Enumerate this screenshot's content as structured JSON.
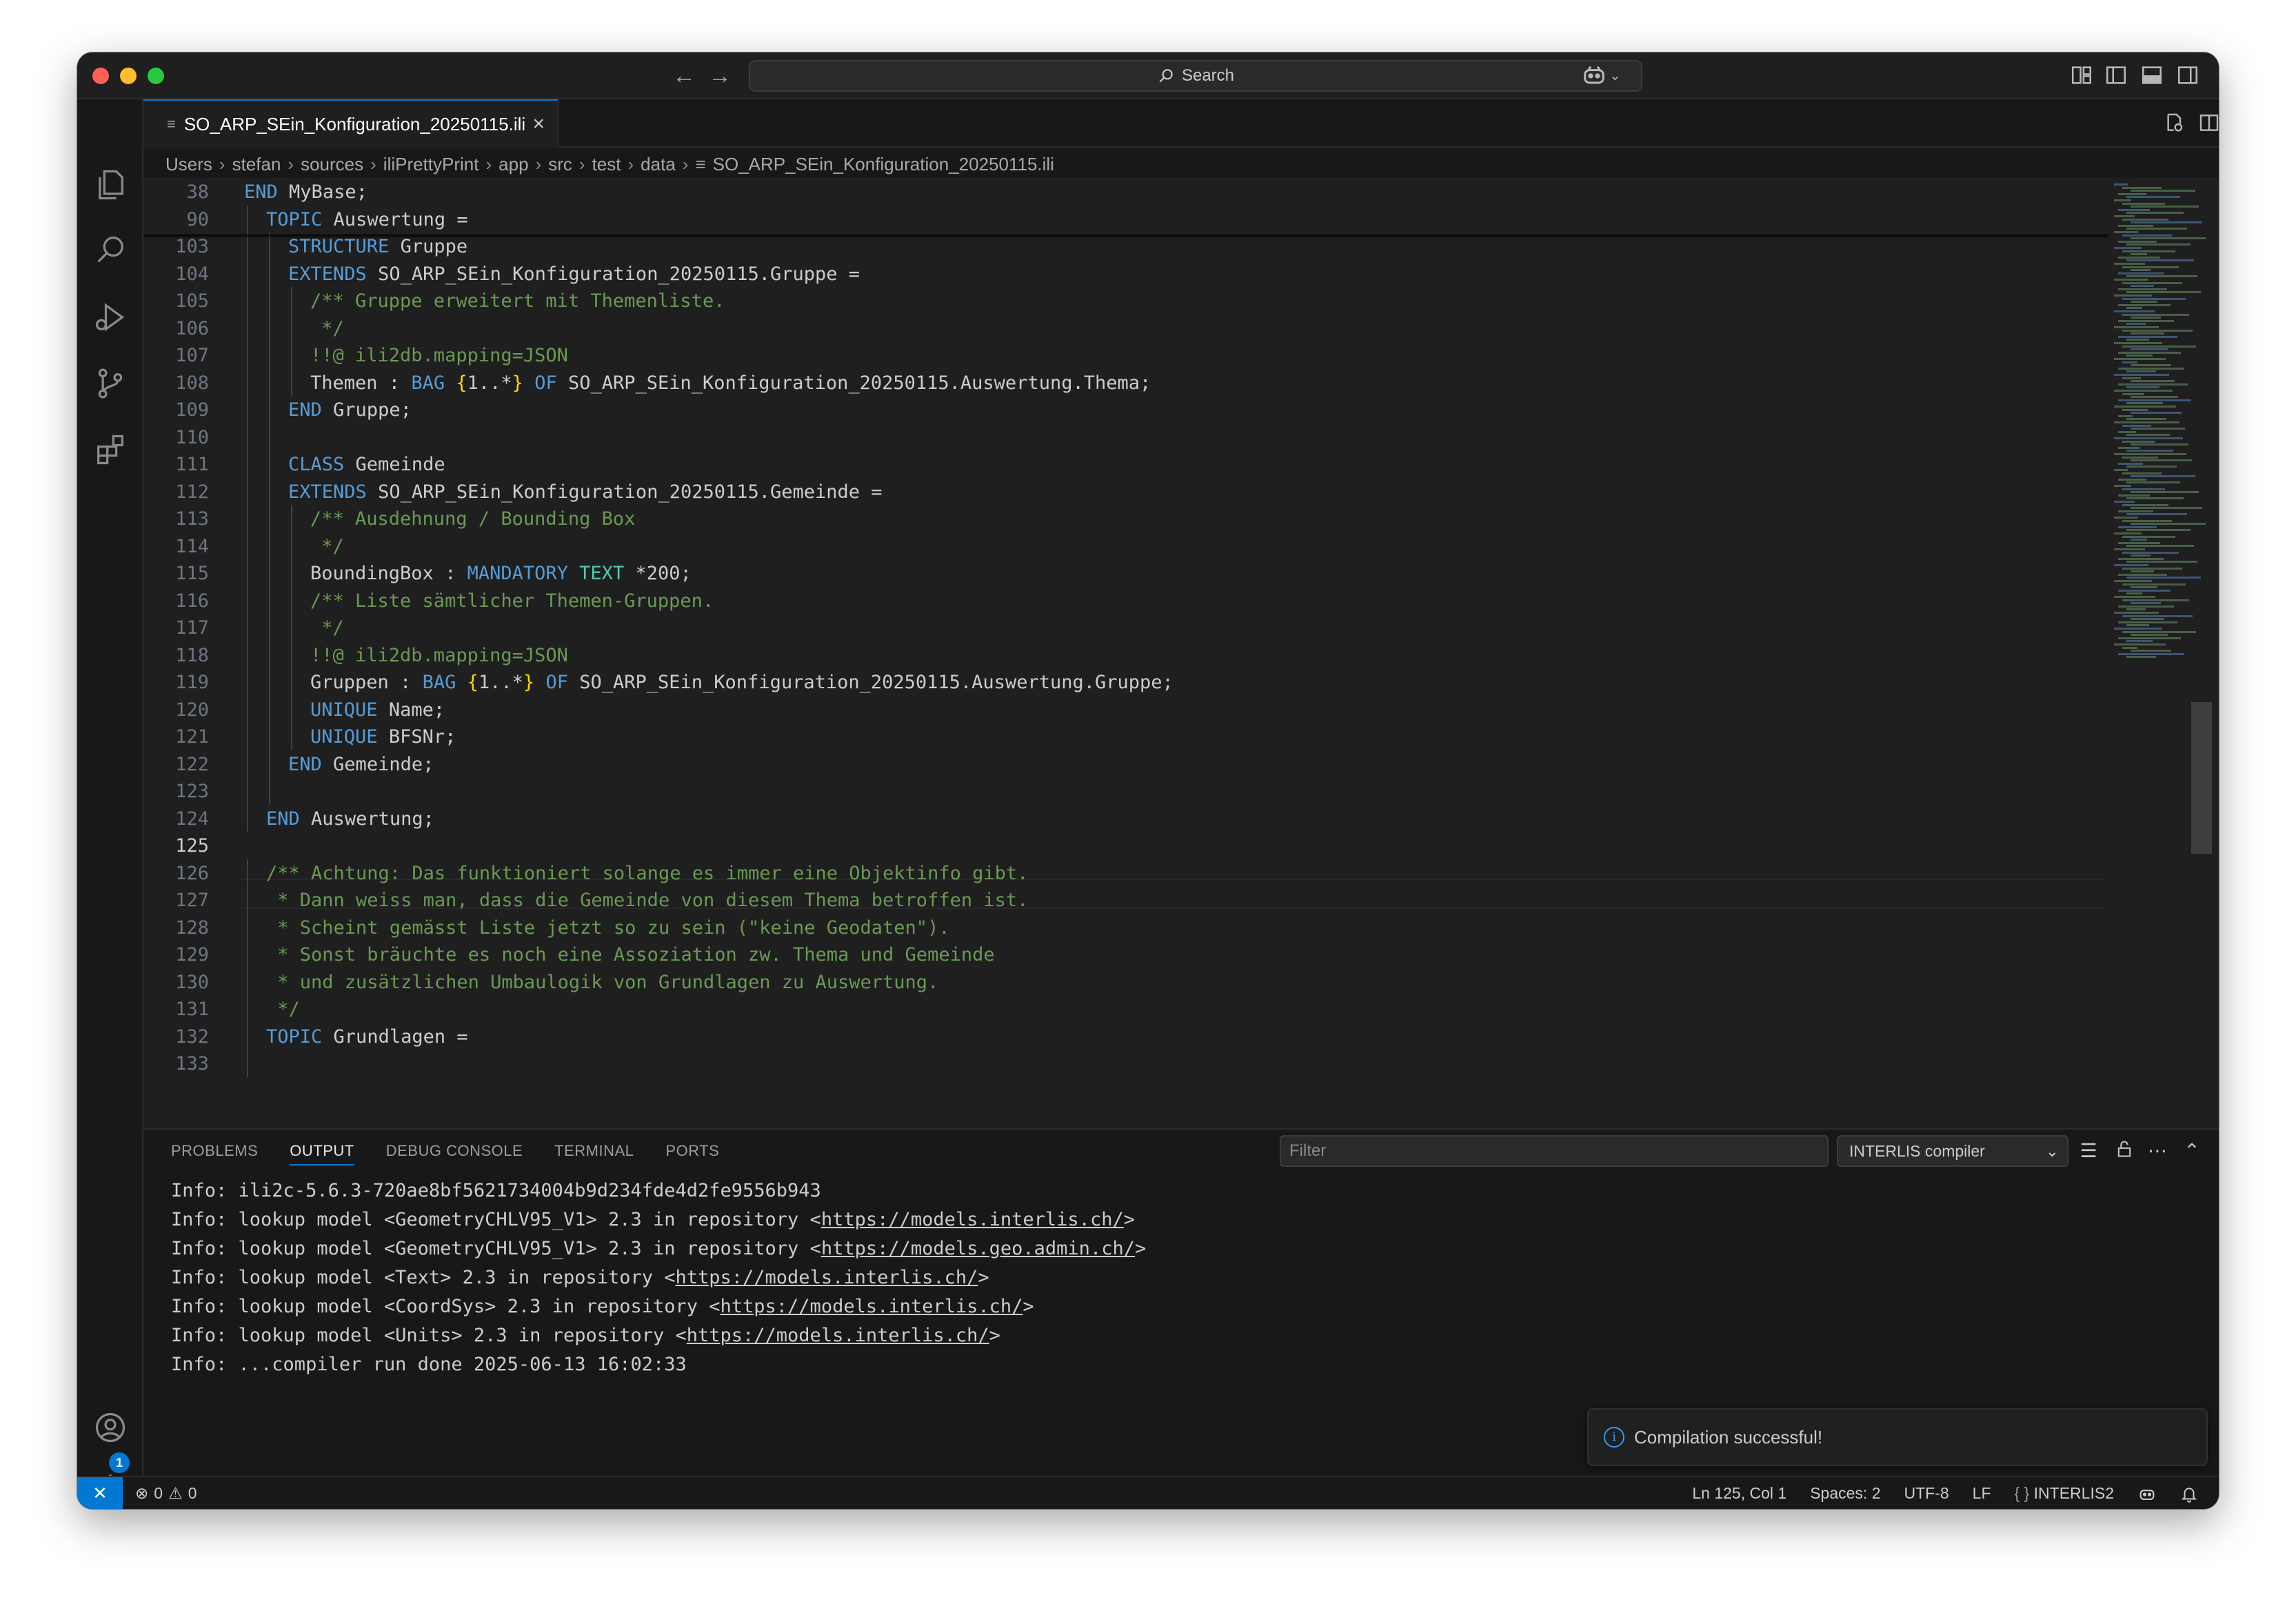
{
  "titlebar": {
    "search_label": "Search"
  },
  "tab": {
    "filename": "SO_ARP_SEin_Konfiguration_20250115.ili"
  },
  "breadcrumb": [
    "Users",
    "stefan",
    "sources",
    "iliPrettyPrint",
    "app",
    "src",
    "test",
    "data",
    "SO_ARP_SEin_Konfiguration_20250115.ili"
  ],
  "editor": {
    "lines": [
      {
        "n": "38",
        "indent": 0,
        "parts": [
          [
            "kw",
            "END"
          ],
          [
            "",
            "MyBase;"
          ]
        ]
      },
      {
        "n": "90",
        "indent": 1,
        "parts": [
          [
            "kw",
            "TOPIC"
          ],
          [
            "",
            "Auswertung ="
          ]
        ]
      },
      {
        "n": "103",
        "indent": 2,
        "parts": [
          [
            "kw",
            "STRUCTURE"
          ],
          [
            "",
            "Gruppe"
          ]
        ]
      },
      {
        "n": "104",
        "indent": 2,
        "parts": [
          [
            "kw",
            "EXTENDS"
          ],
          [
            "",
            "SO_ARP_SEin_Konfiguration_20250115.Gruppe ="
          ]
        ]
      },
      {
        "n": "105",
        "indent": 3,
        "parts": [
          [
            "cm",
            "/** Gruppe erweitert mit Themenliste."
          ]
        ]
      },
      {
        "n": "106",
        "indent": 3,
        "parts": [
          [
            "cm",
            " */"
          ]
        ]
      },
      {
        "n": "107",
        "indent": 3,
        "parts": [
          [
            "cm",
            "!!@ ili2db.mapping=JSON"
          ]
        ]
      },
      {
        "n": "108",
        "indent": 3,
        "parts": [
          [
            "",
            "Themen :"
          ],
          [
            "kw",
            "BAG"
          ],
          [
            "br",
            "{"
          ],
          [
            "",
            "1..*"
          ],
          [
            "br",
            "}"
          ],
          [
            "kw",
            "OF"
          ],
          [
            "",
            "SO_ARP_SEin_Konfiguration_20250115.Auswertung.Thema;"
          ]
        ]
      },
      {
        "n": "109",
        "indent": 2,
        "parts": [
          [
            "kw",
            "END"
          ],
          [
            "",
            "Gruppe;"
          ]
        ]
      },
      {
        "n": "110",
        "indent": 2,
        "parts": []
      },
      {
        "n": "111",
        "indent": 2,
        "parts": [
          [
            "kw",
            "CLASS"
          ],
          [
            "",
            "Gemeinde"
          ]
        ]
      },
      {
        "n": "112",
        "indent": 2,
        "parts": [
          [
            "kw",
            "EXTENDS"
          ],
          [
            "",
            "SO_ARP_SEin_Konfiguration_20250115.Gemeinde ="
          ]
        ]
      },
      {
        "n": "113",
        "indent": 3,
        "parts": [
          [
            "cm",
            "/** Ausdehnung / Bounding Box"
          ]
        ]
      },
      {
        "n": "114",
        "indent": 3,
        "parts": [
          [
            "cm",
            " */"
          ]
        ]
      },
      {
        "n": "115",
        "indent": 3,
        "parts": [
          [
            "",
            "BoundingBox :"
          ],
          [
            "kw",
            "MANDATORY"
          ],
          [
            "ty",
            "TEXT"
          ],
          [
            "",
            "*200;"
          ]
        ]
      },
      {
        "n": "116",
        "indent": 3,
        "parts": [
          [
            "cm",
            "/** Liste sämtlicher Themen-Gruppen."
          ]
        ]
      },
      {
        "n": "117",
        "indent": 3,
        "parts": [
          [
            "cm",
            " */"
          ]
        ]
      },
      {
        "n": "118",
        "indent": 3,
        "parts": [
          [
            "cm",
            "!!@ ili2db.mapping=JSON"
          ]
        ]
      },
      {
        "n": "119",
        "indent": 3,
        "parts": [
          [
            "",
            "Gruppen :"
          ],
          [
            "kw",
            "BAG"
          ],
          [
            "br",
            "{"
          ],
          [
            "",
            "1..*"
          ],
          [
            "br",
            "}"
          ],
          [
            "kw",
            "OF"
          ],
          [
            "",
            "SO_ARP_SEin_Konfiguration_20250115.Auswertung.Gruppe;"
          ]
        ]
      },
      {
        "n": "120",
        "indent": 3,
        "parts": [
          [
            "kw",
            "UNIQUE"
          ],
          [
            "",
            "Name;"
          ]
        ]
      },
      {
        "n": "121",
        "indent": 3,
        "parts": [
          [
            "kw",
            "UNIQUE"
          ],
          [
            "",
            "BFSNr;"
          ]
        ]
      },
      {
        "n": "122",
        "indent": 2,
        "parts": [
          [
            "kw",
            "END"
          ],
          [
            "",
            "Gemeinde;"
          ]
        ]
      },
      {
        "n": "123",
        "indent": 2,
        "parts": []
      },
      {
        "n": "124",
        "indent": 1,
        "parts": [
          [
            "kw",
            "END"
          ],
          [
            "",
            "Auswertung;"
          ]
        ]
      },
      {
        "n": "125",
        "indent": 0,
        "parts": [],
        "active": true
      },
      {
        "n": "126",
        "indent": 1,
        "parts": [
          [
            "cm",
            "/** Achtung: Das funktioniert solange es immer eine Objektinfo gibt."
          ]
        ]
      },
      {
        "n": "127",
        "indent": 1,
        "parts": [
          [
            "cm",
            " * Dann weiss man, dass die Gemeinde von diesem Thema betroffen ist."
          ]
        ]
      },
      {
        "n": "128",
        "indent": 1,
        "parts": [
          [
            "cm",
            " * Scheint gemässt Liste jetzt so zu sein (\"keine Geodaten\")."
          ]
        ]
      },
      {
        "n": "129",
        "indent": 1,
        "parts": [
          [
            "cm",
            " * Sonst bräuchte es noch eine Assoziation zw. Thema und Gemeinde"
          ]
        ]
      },
      {
        "n": "130",
        "indent": 1,
        "parts": [
          [
            "cm",
            " * und zusätzlichen Umbaulogik von Grundlagen zu Auswertung."
          ]
        ]
      },
      {
        "n": "131",
        "indent": 1,
        "parts": [
          [
            "cm",
            " */"
          ]
        ]
      },
      {
        "n": "132",
        "indent": 1,
        "parts": [
          [
            "kw",
            "TOPIC"
          ],
          [
            "",
            "Grundlagen ="
          ]
        ]
      },
      {
        "n": "133",
        "indent": 1,
        "parts": []
      }
    ]
  },
  "panel": {
    "tabs": [
      "PROBLEMS",
      "OUTPUT",
      "DEBUG CONSOLE",
      "TERMINAL",
      "PORTS"
    ],
    "active_tab": "OUTPUT",
    "filter_placeholder": "Filter",
    "channel": "INTERLIS compiler",
    "output": [
      {
        "text": "Info: ili2c-5.6.3-720ae8bf5621734004b9d234fde4d2fe9556b943",
        "url": "",
        "tail": ""
      },
      {
        "text": "Info: lookup model <GeometryCHLV95_V1> 2.3 in repository <",
        "url": "https://models.interlis.ch/",
        "tail": ">"
      },
      {
        "text": "Info: lookup model <GeometryCHLV95_V1> 2.3 in repository <",
        "url": "https://models.geo.admin.ch/",
        "tail": ">"
      },
      {
        "text": "Info: lookup model <Text> 2.3 in repository <",
        "url": "https://models.interlis.ch/",
        "tail": ">"
      },
      {
        "text": "Info: lookup model <CoordSys> 2.3 in repository <",
        "url": "https://models.interlis.ch/",
        "tail": ">"
      },
      {
        "text": "Info: lookup model <Units> 2.3 in repository <",
        "url": "https://models.interlis.ch/",
        "tail": ">"
      },
      {
        "text": "Info: ...compiler run done 2025-06-13 16:02:33",
        "url": "",
        "tail": ""
      }
    ]
  },
  "toast": {
    "message": "Compilation successful!"
  },
  "statusbar": {
    "errors": "0",
    "warnings": "0",
    "position": "Ln 125, Col 1",
    "spaces": "Spaces: 2",
    "encoding": "UTF-8",
    "eol": "LF",
    "language": "INTERLIS2",
    "settings_badge": "1"
  },
  "colors": {
    "accent": "#0078d4",
    "keyword": "#569cd6",
    "comment": "#6a9955",
    "type": "#4ec9b0",
    "bracket": "#ffd700"
  }
}
